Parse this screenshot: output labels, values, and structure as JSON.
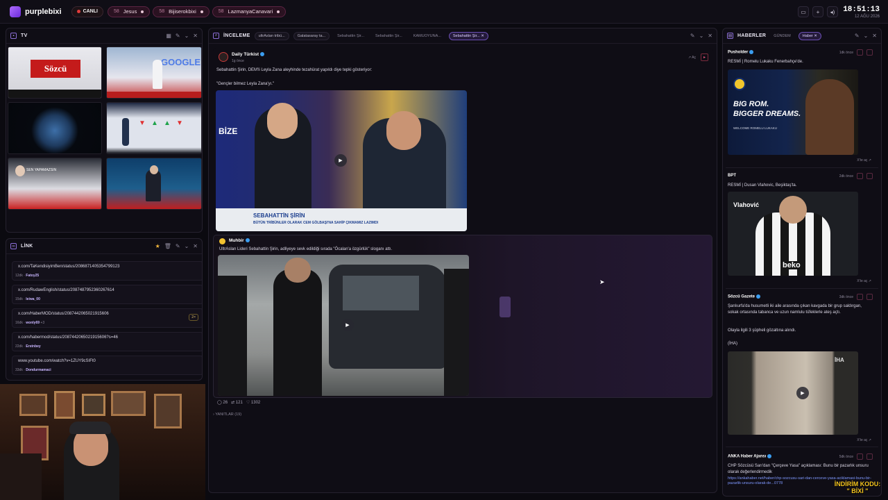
{
  "app": {
    "name": "purplebixi"
  },
  "topbar": {
    "live_label": "CANLI",
    "channels": [
      {
        "count": "58",
        "name": "Jesus"
      },
      {
        "count": "58",
        "name": "Bijiserokbixi"
      },
      {
        "count": "58",
        "name": "LazmanyaCanavari"
      }
    ],
    "clock": "18:51:13",
    "date": "12 AĞU 2026"
  },
  "tv_panel": {
    "title": "TV",
    "thumb_labels": [
      "Sözcü",
      "GOOGLE",
      "",
      "",
      "SEN YAPAMAZSIN",
      ""
    ]
  },
  "link_panel": {
    "title": "LİNK",
    "links": [
      {
        "url": "x.com/TaKendisiyimBen/status/2086871405354799123",
        "time": "12dk",
        "user": "Fatoy25",
        "extra": "",
        "badge": ""
      },
      {
        "url": "x.com/RudawEnglish/status/2087487952360267614",
        "time": "15dk",
        "user": "leiwa_00",
        "extra": "",
        "badge": ""
      },
      {
        "url": "x.com/HaberMOD/status/2087442065021915606",
        "time": "16dk",
        "user": "wonly69",
        "extra": "+3",
        "badge": "2×"
      },
      {
        "url": "x.com/habermod/status/2087442065021915606?s=46",
        "time": "22dk",
        "user": "Erstnbey",
        "extra": "",
        "badge": ""
      },
      {
        "url": "www.youtube.com/watch?v=1ZUY9cSIFt0",
        "time": "33dk",
        "user": "Dondurmamaci",
        "extra": "",
        "badge": ""
      }
    ]
  },
  "inceleme_panel": {
    "title": "İNCELEME",
    "tabs": [
      "ultrAslan tribü...",
      "Galatasaray ta...",
      "Sebahattin Şir...",
      "Sebahattin Şir...",
      "KAMUOYUNA...",
      "Sebahattin Şir..."
    ],
    "post1": {
      "source": "Daily Türkist",
      "time": "1g önce",
      "open": "Aç",
      "text1": "Sebahattin Şirin, DEM'li Leyla Zana aleyhinde tezahürat yapıldı diye tepki gösteriyor:",
      "text2": "\"Gençler bilmez Leyla Zana'yı.\"",
      "caption1": "SEBAHATTİN ŞİRİN",
      "caption2": "BÜTÜN TRİBÜNLER OLARAK CEM GÖLBAŞI'NA SAHİP ÇIKMAMIZ LAZIMDI",
      "watermark": "BİZE"
    },
    "post2": {
      "source": "Muhbir",
      "text": "UltrAslan Lideri Sebahattin Şirin, adliyeye sevk edildiği sırada \"Öcalan'a özgürlük\" sloganı attı.",
      "replies": "26",
      "reposts": "121",
      "likes": "1302"
    },
    "replies_label": "YANITLAR (19)"
  },
  "haber_panel": {
    "title": "HABERLER",
    "tabs": [
      "GÜNDEM",
      "Haber"
    ],
    "items": [
      {
        "source": "Pusholder",
        "time": "1dk önce",
        "text": "RESMİ | Romelu Lukaku Fenerbahçe'de.",
        "img_text1": "BIG ROM.",
        "img_text2": "BIGGER DREAMS.",
        "img_text3": "WELCOME ROMELU LUKAKU",
        "open": "X'te aç"
      },
      {
        "source": "BPT",
        "time": "2dk önce",
        "text": "RESMİ | Dusan Vlahovic, Beşiktaş'ta.",
        "img_text1": "Vlahović",
        "img_text2": "beko",
        "open": "X'te aç"
      },
      {
        "source": "Sözcü Gazete",
        "time": "3dk önce",
        "text": "Şanlıurfa'da husumetli iki aile arasında çıkan kavgada bir grup saldırgan, sokak ortasında tabanca ve uzun namlulu tüfeklerle ateş açtı.",
        "text2": "Olayla ilgili 3 şüpheli gözaltına alındı.",
        "text3": "(İHA)",
        "img_text1": "İHA",
        "open": "X'te aç"
      },
      {
        "source": "ANKA Haber Ajansı",
        "time": "5dk önce",
        "text": "CHP Sözcüsü Sarı'dan \"Çerçeve Yasa\" açıklaması: Bunu bir pazarlık unsuru olarak değerlendirmedik",
        "link": "https://ankahaber.net/haber/chp-sozcusu-sari-dan-cerceve-yasa-aciklamasi-bunu-bir-pazarlik-unsuru-olarak-de...0778"
      }
    ]
  },
  "overlay": {
    "line1": "İNDİRİM KODU:",
    "line2": "\" BİXİ \""
  },
  "colors": {
    "accent": "#8c6fd8",
    "live": "#e23b3b",
    "pill": "#2a1221",
    "bg": "#0b0a10"
  }
}
